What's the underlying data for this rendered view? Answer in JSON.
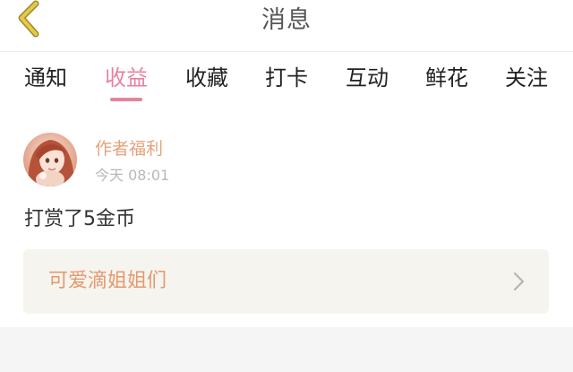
{
  "header": {
    "title": "消息",
    "back_icon": "chevron-left-icon",
    "back_icon_color": "#e7c94a"
  },
  "tabs": [
    {
      "label": "通知",
      "active": false
    },
    {
      "label": "收益",
      "active": true
    },
    {
      "label": "收藏",
      "active": false
    },
    {
      "label": "打卡",
      "active": false
    },
    {
      "label": "互动",
      "active": false
    },
    {
      "label": "鲜花",
      "active": false
    },
    {
      "label": "关注",
      "active": false
    }
  ],
  "message": {
    "avatar_icon": "user-avatar",
    "author": "作者福利",
    "time": "今天 08:01",
    "body": "打赏了5金币",
    "card": {
      "label": "可爱滴姐姐们",
      "icon": "chevron-right-icon"
    }
  },
  "colors": {
    "accent_pink": "#e5839f",
    "author_orange": "#e5a27d",
    "card_bg": "#f6f4ee"
  }
}
